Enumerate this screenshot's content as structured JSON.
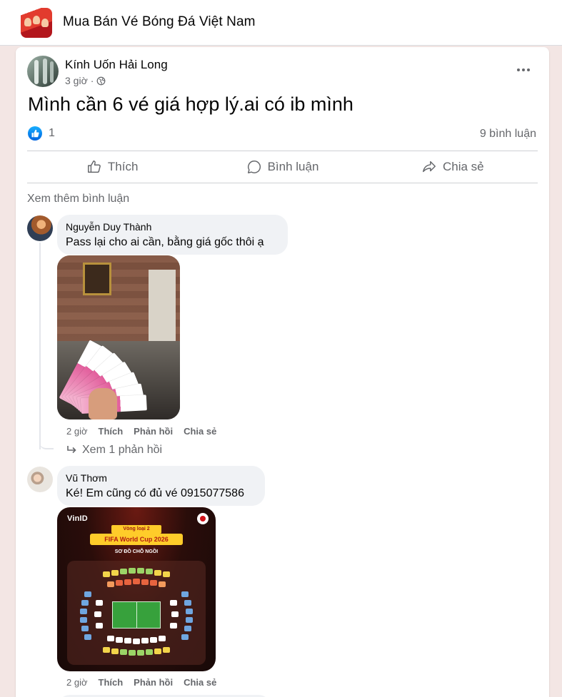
{
  "group": {
    "title": "Mua Bán Vé Bóng Đá Việt Nam"
  },
  "post": {
    "author": "Kính Uốn Hải Long",
    "time": "3 giờ",
    "text": "Mình cần 6 vé giá hợp lý.ai có ib mình",
    "reaction_count": "1",
    "comment_count": "9 bình luận",
    "actions": {
      "like": "Thích",
      "comment": "Bình luận",
      "share": "Chia sẻ"
    },
    "more_comments": "Xem thêm bình luận"
  },
  "comments": [
    {
      "name": "Nguyễn Duy Thành",
      "text": "Pass lại cho ai cần, bằng giá gốc thôi ạ",
      "time": "2 giờ",
      "like": "Thích",
      "reply": "Phản hồi",
      "share": "Chia sẻ",
      "replies_link": "Xem 1 phản hồi"
    },
    {
      "name": "Vũ Thơm",
      "text": "Ké! Em cũng có đủ vé 0915077586",
      "time": "2 giờ",
      "like": "Thích",
      "reply": "Phản hồi",
      "share": "Chia sẻ",
      "image_text": {
        "brand": "VinID",
        "round": "Vòng loại 2",
        "event": "FIFA World Cup 2026",
        "subtitle": "SƠ ĐỒ CHỖ NGỒI"
      }
    }
  ],
  "colors": {
    "page_bg": "#f3e6e4",
    "card_bg": "#ffffff",
    "bubble_bg": "#f0f2f5",
    "secondary_text": "#65676b",
    "like_blue": "#0866ff"
  }
}
